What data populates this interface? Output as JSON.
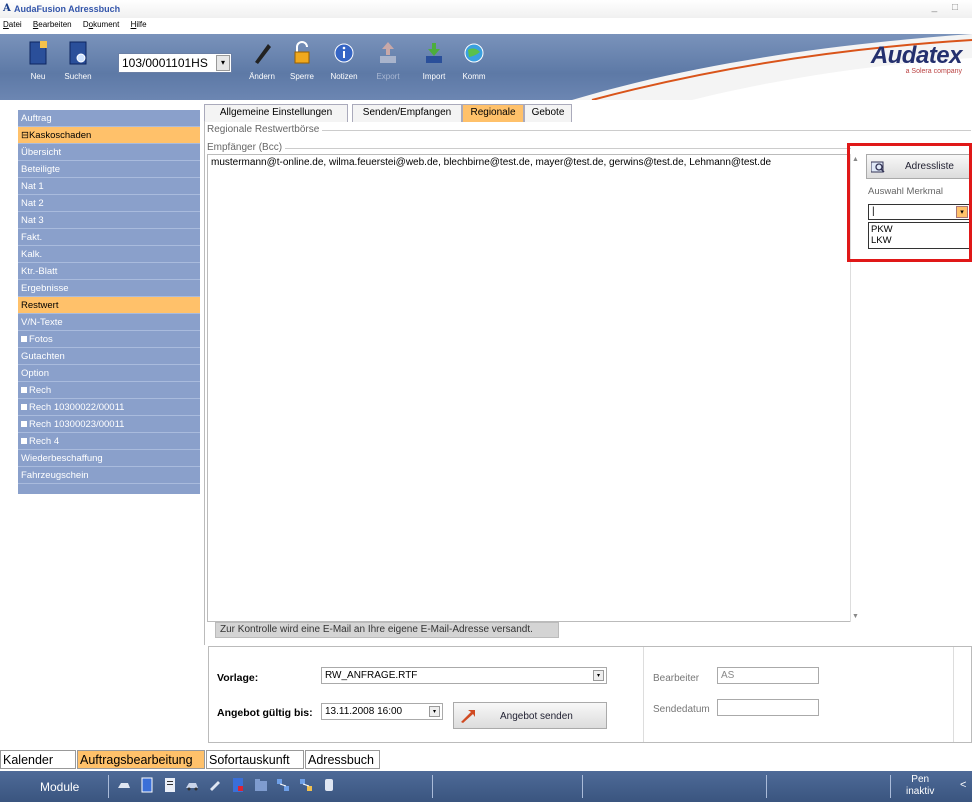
{
  "window": {
    "title": "AudaFusion Adressbuch",
    "controls": "_ □"
  },
  "menu": [
    {
      "label": "Datei",
      "underline": "D",
      "rest": "atei"
    },
    {
      "label": "Bearbeiten",
      "underline": "B",
      "rest": "earbeiten"
    },
    {
      "label": "Dokument",
      "underline": "o",
      "rest": "kument",
      "prefix": "D"
    },
    {
      "label": "Hilfe",
      "underline": "H",
      "rest": "ilfe"
    }
  ],
  "toolbar": {
    "new_label": "Neu",
    "search_label": "Suchen",
    "record_number": "103/0001101HS",
    "edit_label": "Ändern",
    "lock_label": "Sperre",
    "notes_label": "Notizen",
    "export_label": "Export",
    "import_label": "Import",
    "comm_label": "Komm"
  },
  "logo": {
    "brand": "Audatex",
    "tagline": "a Solera company"
  },
  "sidebar": {
    "items": [
      {
        "label": "Auftrag",
        "style": "header"
      },
      {
        "label": "Kaskoschaden",
        "style": "orange",
        "marker": "⊟"
      },
      {
        "label": "Übersicht"
      },
      {
        "label": "Beteiligte"
      },
      {
        "label": "Nat 1"
      },
      {
        "label": "Nat 2"
      },
      {
        "label": "Nat 3"
      },
      {
        "label": "Fakt."
      },
      {
        "label": "Kalk."
      },
      {
        "label": "Ktr.-Blatt"
      },
      {
        "label": "Ergebnisse"
      },
      {
        "label": "Restwert",
        "style": "orange"
      },
      {
        "label": "V/N-Texte"
      },
      {
        "label": "Fotos",
        "plus": true
      },
      {
        "label": "Gutachten"
      },
      {
        "label": "Option"
      },
      {
        "label": "Rech",
        "plus": true
      },
      {
        "label": "Rech 10300022/00011",
        "plus": true
      },
      {
        "label": "Rech 10300023/00011",
        "plus": true
      },
      {
        "label": "Rech 4",
        "plus": true
      },
      {
        "label": "Wiederbeschaffung"
      },
      {
        "label": "Fahrzeugschein"
      }
    ]
  },
  "tabs": [
    {
      "label": "Allgemeine Einstellungen"
    },
    {
      "label": "Senden/Empfangen"
    },
    {
      "label": "Regionale",
      "active": true
    },
    {
      "label": "Gebote"
    }
  ],
  "regional": {
    "group_title": "Regionale Restwertbörse",
    "recipients_label": "Empfänger (Bcc)",
    "recipients": "mustermann@t-online.de, wilma.feuerstei@web.de, blechbirne@test.de, mayer@test.de, gerwins@test.de, Lehmann@test.de",
    "address_list_button": "Adressliste",
    "feature_label": "Auswahl Merkmal",
    "feature_value": "|",
    "feature_options": [
      "PKW",
      "LKW"
    ],
    "control_note": "Zur Kontrolle wird eine E-Mail an Ihre eigene E-Mail-Adresse versandt."
  },
  "form": {
    "template_label": "Vorlage:",
    "template_value": "RW_ANFRAGE.RTF",
    "valid_until_label": "Angebot gültig bis:",
    "valid_until_value": "13.11.2008 16:00",
    "send_button": "Angebot senden",
    "editor_label": "Bearbeiter",
    "editor_value": "AS",
    "send_date_label": "Sendedatum",
    "send_date_value": ""
  },
  "module_tabs": [
    {
      "label": "Kalender"
    },
    {
      "label": "Auftragsbearbeitung",
      "active": true
    },
    {
      "label": "Sofortauskunft"
    },
    {
      "label": "Adressbuch"
    }
  ],
  "taskbar": {
    "module_label": "Module",
    "pen_line1": "Pen",
    "pen_line2": "inaktiv"
  },
  "colors": {
    "accent_orange": "#ffc16a",
    "nav_blue": "#8aa0cb",
    "toolbar_blue": "#5d79a6",
    "highlight_red": "#e01818"
  }
}
